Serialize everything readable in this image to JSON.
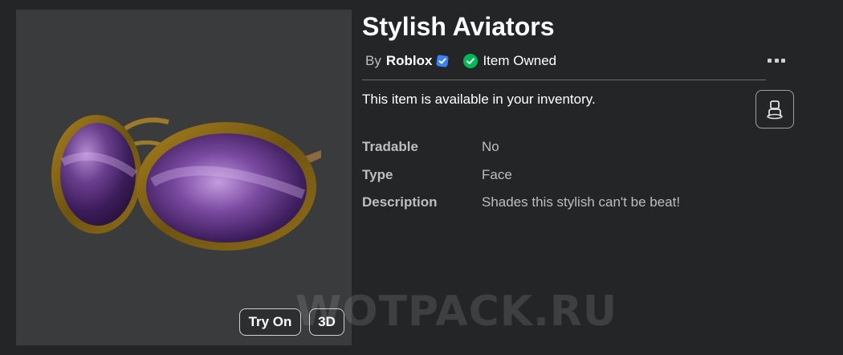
{
  "item": {
    "title": "Stylish Aviators",
    "by_label": "By",
    "creator": "Roblox",
    "owned_status": "Item Owned",
    "availability": "This item is available in your inventory."
  },
  "preview": {
    "try_on_label": "Try On",
    "three_d_label": "3D"
  },
  "details": [
    {
      "label": "Tradable",
      "value": "No"
    },
    {
      "label": "Type",
      "value": "Face"
    },
    {
      "label": "Description",
      "value": "Shades this stylish can't be beat!"
    }
  ],
  "watermark": "WOTPACK.RU",
  "colors": {
    "background": "#232527",
    "preview_bg": "#393b3d",
    "verified_badge": "#3b82f6",
    "owned_check": "#02b757",
    "muted_text": "#bdbebe"
  },
  "icons": {
    "verified": "verified-badge-icon",
    "owned": "checkmark-circle-icon",
    "more": "more-options-icon",
    "avatar": "avatar-icon"
  }
}
